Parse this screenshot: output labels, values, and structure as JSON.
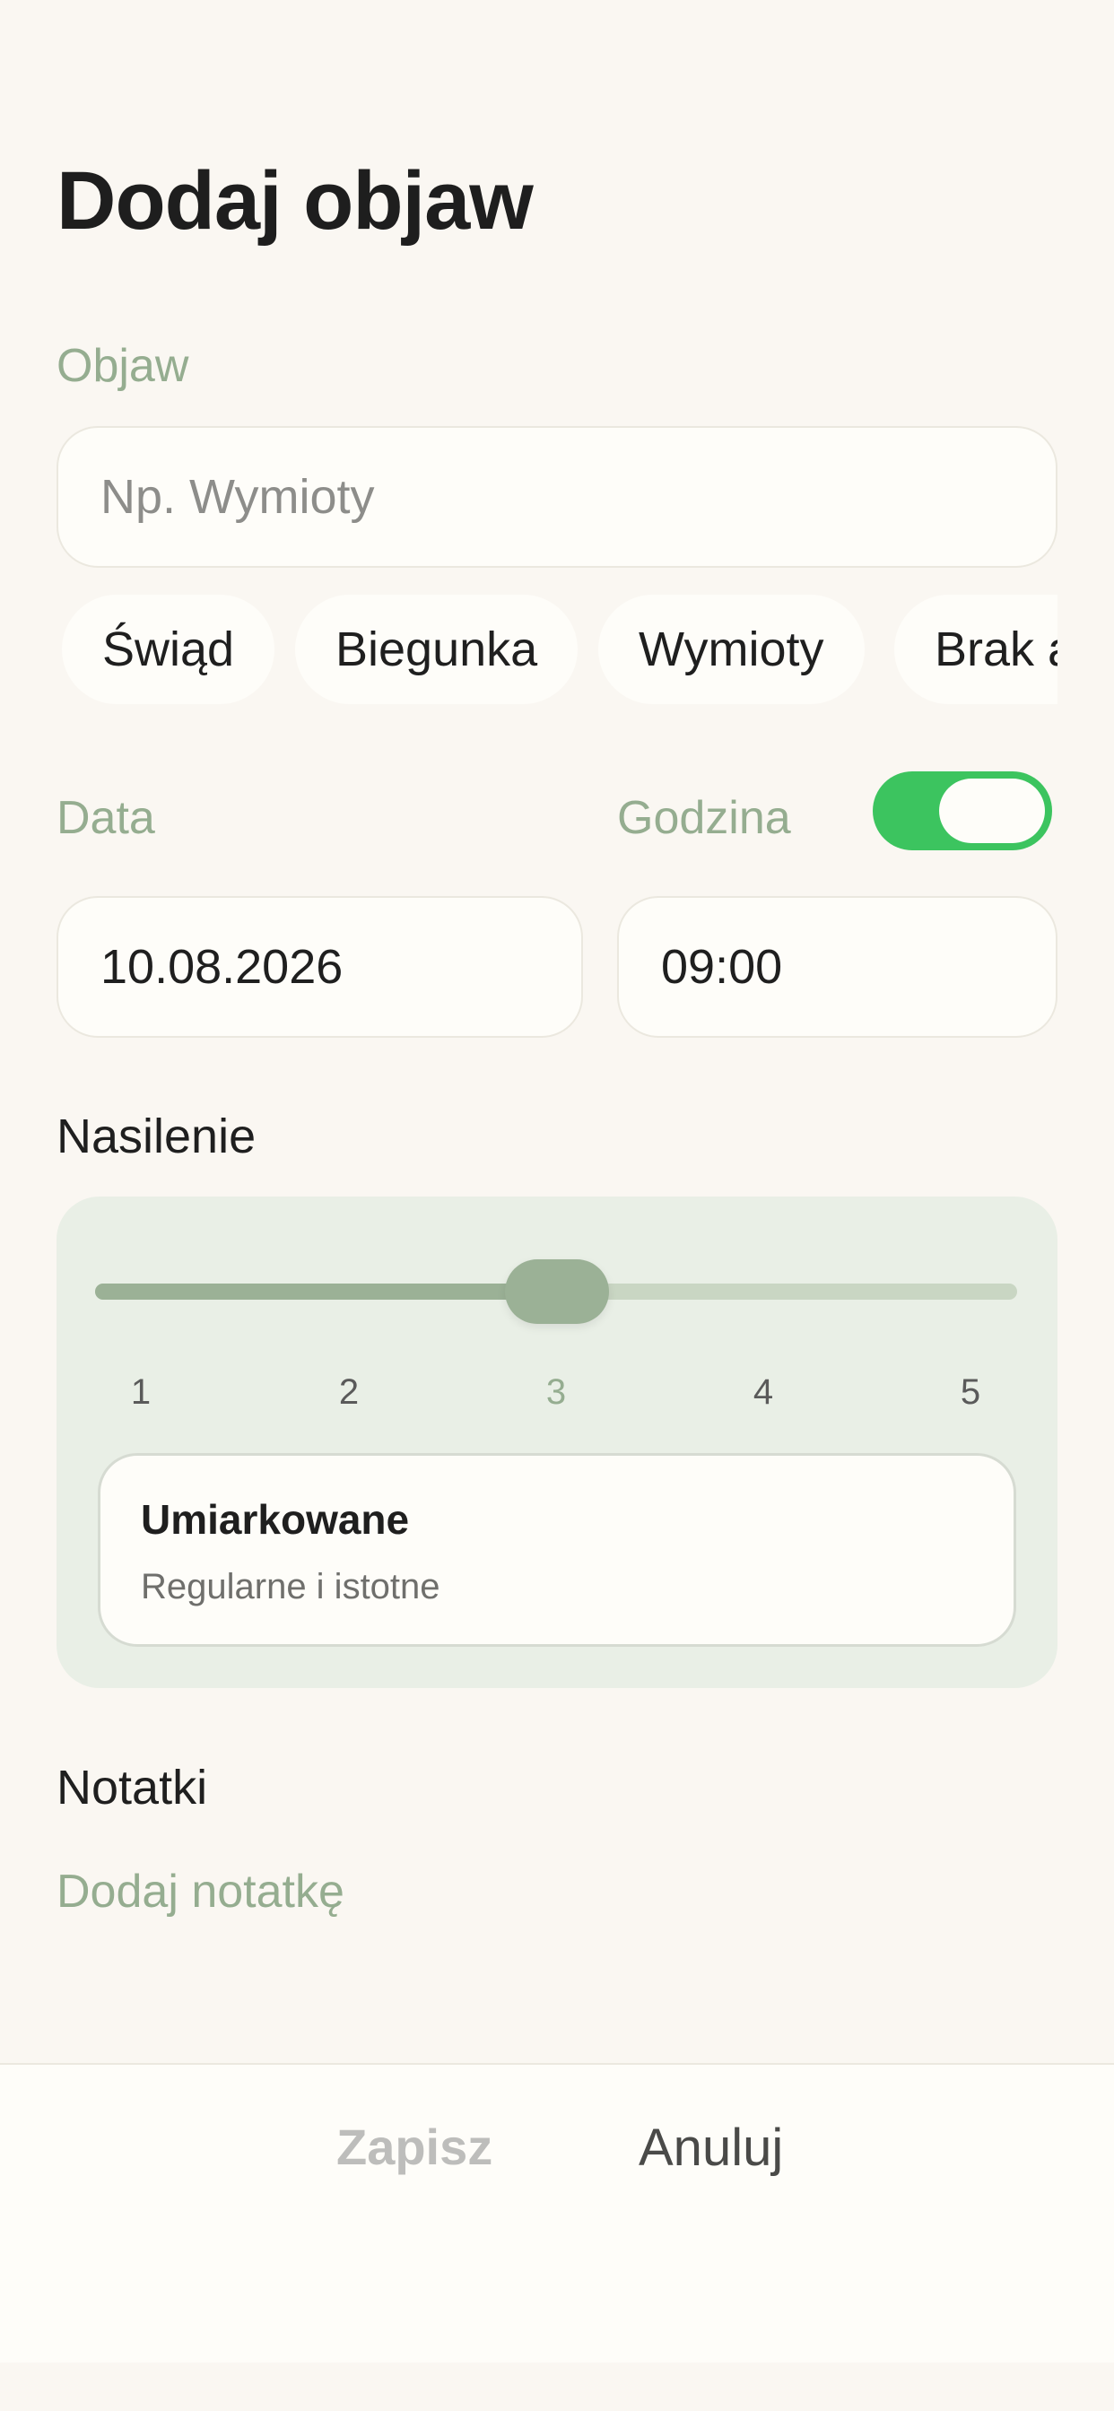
{
  "page": {
    "title": "Dodaj objaw"
  },
  "symptom": {
    "label": "Objaw",
    "placeholder": "Np. Wymioty",
    "suggestions": [
      "Świąd",
      "Biegunka",
      "Wymioty",
      "Brak a"
    ]
  },
  "date": {
    "label": "Data",
    "value": "10.08.2026"
  },
  "time": {
    "label": "Godzina",
    "value": "09:00",
    "toggle_on": true
  },
  "severity": {
    "label": "Nasilenie",
    "ticks": [
      "1",
      "2",
      "3",
      "4",
      "5"
    ],
    "selected": 3,
    "level_title": "Umiarkowane",
    "level_description": "Regularne i istotne"
  },
  "notes": {
    "label": "Notatki",
    "add_label": "Dodaj notatkę"
  },
  "actions": {
    "save_label": "Zapisz",
    "cancel_label": "Anuluj"
  },
  "colors": {
    "background": "#faf7f2",
    "accent_green": "#95ad90",
    "toggle_green": "#3cc45f",
    "card_green": "#e9efe6"
  }
}
